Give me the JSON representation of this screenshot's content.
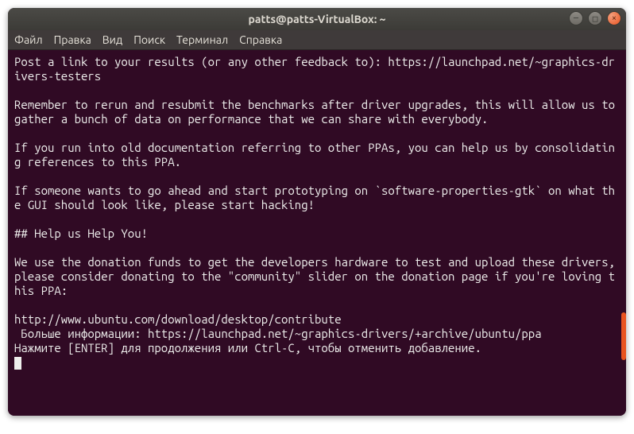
{
  "window": {
    "title": "patts@patts-VirtualBox: ~"
  },
  "menubar": {
    "items": [
      "Файл",
      "Правка",
      "Вид",
      "Поиск",
      "Терминал",
      "Справка"
    ]
  },
  "terminal": {
    "text": "Post a link to your results (or any other feedback to): https://launchpad.net/~graphics-drivers-testers\n\nRemember to rerun and resubmit the benchmarks after driver upgrades, this will allow us to gather a bunch of data on performance that we can share with everybody.\n\nIf you run into old documentation referring to other PPAs, you can help us by consolidating references to this PPA.\n\nIf someone wants to go ahead and start prototyping on `software-properties-gtk` on what the GUI should look like, please start hacking!\n\n## Help us Help You!\n\nWe use the donation funds to get the developers hardware to test and upload these drivers, please consider donating to the \"community\" slider on the donation page if you're loving this PPA:\n\nhttp://www.ubuntu.com/download/desktop/contribute\n Больше информации: https://launchpad.net/~graphics-drivers/+archive/ubuntu/ppa\nНажмите [ENTER] для продолжения или Ctrl-C, чтобы отменить добавление."
  },
  "icons": {
    "minimize": "—",
    "maximize": "□",
    "close": "×"
  }
}
